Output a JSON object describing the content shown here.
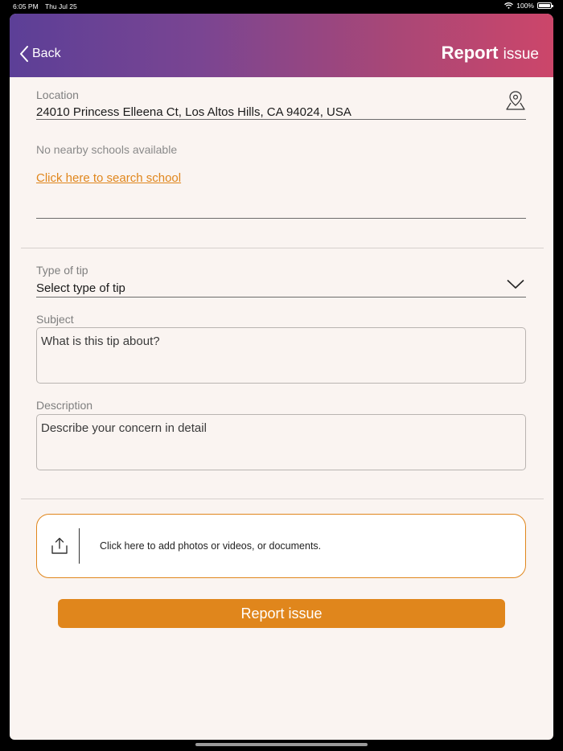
{
  "status_bar": {
    "time": "6:05 PM",
    "date": "Thu Jul 25",
    "battery": "100%"
  },
  "nav": {
    "back_label": "Back",
    "title_bold": "Report",
    "title_light": "issue"
  },
  "location": {
    "label": "Location",
    "value": "24010 Princess Elleena Ct, Los Altos Hills, CA 94024, USA",
    "icon": "map-pin-icon"
  },
  "school": {
    "none_text": "No nearby schools available",
    "search_link": "Click here to search school"
  },
  "tip_type": {
    "label": "Type of tip",
    "value": "Select type of tip"
  },
  "subject": {
    "label": "Subject",
    "placeholder": "What is this tip about?"
  },
  "description": {
    "label": "Description",
    "placeholder": "Describe your concern in detail"
  },
  "upload": {
    "text": "Click here to add photos or videos, or documents."
  },
  "submit": {
    "label": "Report issue"
  },
  "colors": {
    "accent": "#e0861c",
    "header_start": "#5c3f97",
    "header_end": "#cc466a",
    "background": "#faf4f1"
  }
}
